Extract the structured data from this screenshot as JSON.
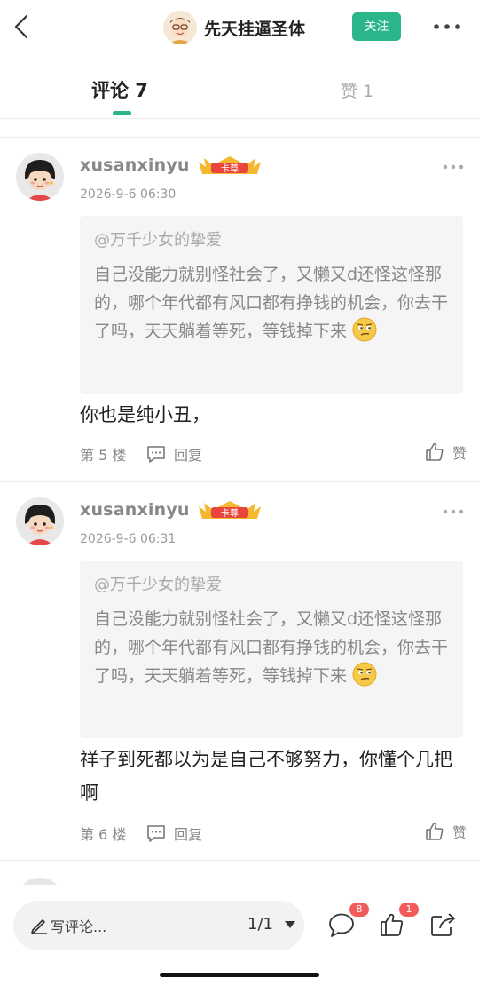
{
  "header": {
    "author_name": "先天挂逼圣体",
    "follow_label": "关注",
    "icons": {
      "back": "back-chevron-icon",
      "more": "more-dots-icon"
    }
  },
  "tabs": {
    "comments_label": "评论 7",
    "likes_label": "赞 1"
  },
  "comments": [
    {
      "username": "xusanxinyu",
      "badge_text": "卡尊",
      "time": "2026-9-6 06:30",
      "quote_author": "@万千少女的挚爱",
      "quote_text": "自己没能力就别怪社会了，又懒又d还怪这怪那的，哪个年代都有风口都有挣钱的机会，你去干了吗，天天躺着等死，等钱掉下来",
      "text": "你也是纯小丑，",
      "floor": "第 5 楼",
      "reply_label": "回复",
      "like_label": "赞"
    },
    {
      "username": "xusanxinyu",
      "badge_text": "卡尊",
      "time": "2026-9-6 06:31",
      "quote_author": "@万千少女的挚爱",
      "quote_text": "自己没能力就别怪社会了，又懒又d还怪这怪那的，哪个年代都有风口都有挣钱的机会，你去干了吗，天天躺着等死，等钱掉下来",
      "text": "祥子到死都以为是自己不够努力，你懂个几把啊",
      "floor": "第 6 楼",
      "reply_label": "回复",
      "like_label": "赞"
    }
  ],
  "bottom_bar": {
    "write_label": "写评论...",
    "page_indicator": "1/1",
    "comment_count": "8",
    "like_count": "1"
  },
  "colors": {
    "accent": "#2bb58a",
    "badge_red": "#f35a5a",
    "quote_bg": "#f5f5f5"
  }
}
